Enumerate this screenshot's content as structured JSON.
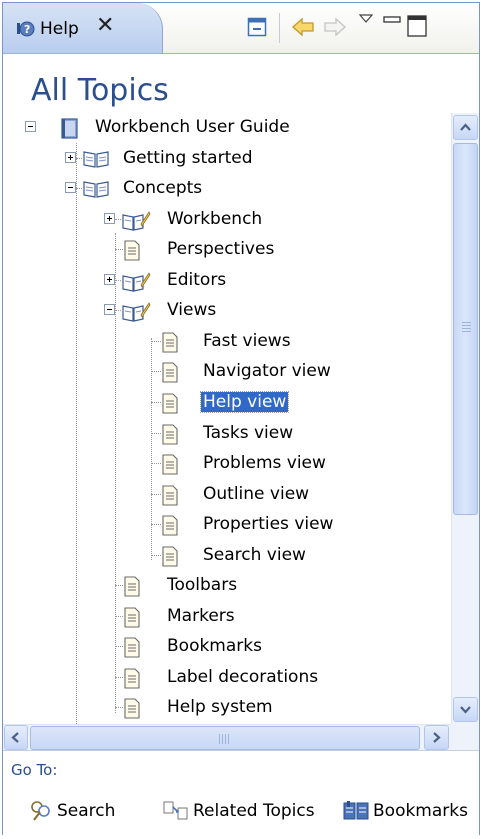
{
  "tab": {
    "title": "Help",
    "close_glyph": "✕"
  },
  "toolbar": {
    "buttons": [
      {
        "name": "collapse-all-icon"
      },
      {
        "name": "back-arrow-icon"
      },
      {
        "name": "forward-arrow-icon"
      },
      {
        "name": "view-menu-icon"
      },
      {
        "name": "minimize-icon"
      },
      {
        "name": "maximize-icon"
      }
    ]
  },
  "heading": "All Topics",
  "tree": {
    "nodes": [
      {
        "label": "Workbench User Guide",
        "expander": "minus",
        "icon": "book-blue-icon"
      },
      {
        "label": "Getting started",
        "expander": "plus",
        "icon": "book-open-icon"
      },
      {
        "label": "Concepts",
        "expander": "minus",
        "icon": "book-open-icon"
      },
      {
        "label": "Workbench",
        "expander": "plus",
        "icon": "book-pencil-icon"
      },
      {
        "label": "Perspectives",
        "expander": null,
        "icon": "page-icon"
      },
      {
        "label": "Editors",
        "expander": "plus",
        "icon": "book-pencil-icon"
      },
      {
        "label": "Views",
        "expander": "minus",
        "icon": "book-pencil-icon"
      },
      {
        "label": "Fast views",
        "expander": null,
        "icon": "page-icon"
      },
      {
        "label": "Navigator view",
        "expander": null,
        "icon": "page-icon"
      },
      {
        "label": "Help view",
        "expander": null,
        "icon": "page-icon",
        "selected": true
      },
      {
        "label": "Tasks view",
        "expander": null,
        "icon": "page-icon"
      },
      {
        "label": "Problems view",
        "expander": null,
        "icon": "page-icon"
      },
      {
        "label": "Outline view",
        "expander": null,
        "icon": "page-icon"
      },
      {
        "label": "Properties view",
        "expander": null,
        "icon": "page-icon"
      },
      {
        "label": "Search view",
        "expander": null,
        "icon": "page-icon"
      },
      {
        "label": "Toolbars",
        "expander": null,
        "icon": "page-icon"
      },
      {
        "label": "Markers",
        "expander": null,
        "icon": "page-icon"
      },
      {
        "label": "Bookmarks",
        "expander": null,
        "icon": "page-icon"
      },
      {
        "label": "Label decorations",
        "expander": null,
        "icon": "page-icon"
      },
      {
        "label": "Help system",
        "expander": null,
        "icon": "page-icon"
      }
    ]
  },
  "footer": {
    "goto_label": "Go To:",
    "links": [
      {
        "label": "Search",
        "icon": "search-icon"
      },
      {
        "label": "Related Topics",
        "icon": "related-topics-icon"
      },
      {
        "label": "Bookmarks",
        "icon": "bookmarks-icon"
      }
    ]
  },
  "colors": {
    "accent": "#2a4e8e",
    "selection": "#3169c6",
    "tab": "#c6d7f1"
  }
}
